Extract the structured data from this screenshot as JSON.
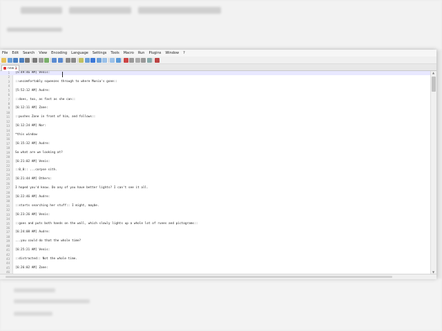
{
  "menu": [
    "File",
    "Edit",
    "Search",
    "View",
    "Encoding",
    "Language",
    "Settings",
    "Tools",
    "Macro",
    "Run",
    "Plugins",
    "Window",
    "?"
  ],
  "tab": {
    "label": "new 1"
  },
  "lines": [
    {
      "n": "1",
      "text": "[5:49:46 AM] Venis:"
    },
    {
      "n": "2",
      "text": ""
    },
    {
      "n": "3",
      "text": "::uncomfortably squeezes through to where Munia's gone::"
    },
    {
      "n": "4",
      "text": ""
    },
    {
      "n": "5",
      "text": "[5:52:12 AM] Audre:"
    },
    {
      "n": "6",
      "text": ""
    },
    {
      "n": "7",
      "text": "::does, too, as fast as she can::"
    },
    {
      "n": "8",
      "text": ""
    },
    {
      "n": "9",
      "text": "[6:12:11 AM] Zane:"
    },
    {
      "n": "10",
      "text": ""
    },
    {
      "n": "11",
      "text": "::pushes Zane in front of him, and follows::"
    },
    {
      "n": "12",
      "text": ""
    },
    {
      "n": "13",
      "text": "[6:12:24 AM] Nor:"
    },
    {
      "n": "14",
      "text": ""
    },
    {
      "n": "15",
      "text": "*this window"
    },
    {
      "n": "16",
      "text": ""
    },
    {
      "n": "17",
      "text": "[6:15:32 AM] Audre:"
    },
    {
      "n": "18",
      "text": ""
    },
    {
      "n": "19",
      "text": "So what are we looking at?"
    },
    {
      "n": "20",
      "text": ""
    },
    {
      "n": "21",
      "text": "[6:21:02 AM] Venis:"
    },
    {
      "n": "22",
      "text": ""
    },
    {
      "n": "23",
      "text": "::0_0:: ...corpse sith."
    },
    {
      "n": "24",
      "text": ""
    },
    {
      "n": "25",
      "text": "[6:21:44 AM] Others:"
    },
    {
      "n": "26",
      "text": ""
    },
    {
      "n": "27",
      "text": "I hoped you'd know. Do any of you have better lights? I can't see it all."
    },
    {
      "n": "28",
      "text": ""
    },
    {
      "n": "29",
      "text": "[6:22:46 AM] Audre:"
    },
    {
      "n": "30",
      "text": ""
    },
    {
      "n": "31",
      "text": "::starts searching her stuff:: I might, maybe."
    },
    {
      "n": "32",
      "text": ""
    },
    {
      "n": "33",
      "text": "[6:23:26 AM] Venis:"
    },
    {
      "n": "34",
      "text": ""
    },
    {
      "n": "35",
      "text": "::goes and puts both hands on the wall, which slowly lights up a whole lot of runes and pictograms::"
    },
    {
      "n": "36",
      "text": ""
    },
    {
      "n": "37",
      "text": "[6:24:08 AM] Audre:"
    },
    {
      "n": "38",
      "text": ""
    },
    {
      "n": "39",
      "text": "...you could do that the whole time?"
    },
    {
      "n": "40",
      "text": ""
    },
    {
      "n": "41",
      "text": "[6:25:21 AM] Venis:"
    },
    {
      "n": "42",
      "text": ""
    },
    {
      "n": "43",
      "text": "::distracted:: Not the whole time."
    },
    {
      "n": "44",
      "text": ""
    },
    {
      "n": "45",
      "text": "[6:26:02 AM] Zane:"
    },
    {
      "n": "46",
      "text": ""
    }
  ],
  "colors": {
    "accent": "#d33333",
    "selection": "#e8e8ff",
    "gutter": "#eeeeee"
  }
}
